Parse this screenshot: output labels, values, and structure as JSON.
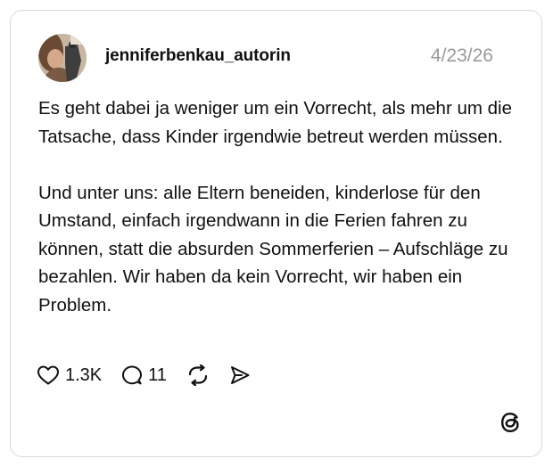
{
  "post": {
    "username": "jenniferbenkau_autorin",
    "date": "4/23/26",
    "paragraphs": [
      "Es geht dabei ja weniger um ein Vorrecht, als mehr um die Tatsache, dass Kinder irgendwie betreut werden müssen.",
      "Und unter uns: alle Eltern beneiden, kinderlose für den Umstand, einfach irgendwann in die Ferien fahren zu können, statt die absurden Sommerferien – Aufschläge zu bezahlen. Wir haben da kein Vorrecht, wir haben ein Problem."
    ],
    "likes": "1.3K",
    "replies": "11"
  },
  "icons": {
    "avatar": "profile-photo",
    "like": "heart-icon",
    "reply": "speech-bubble-icon",
    "repost": "repost-icon",
    "share": "send-icon",
    "brand": "threads-logo"
  },
  "colors": {
    "text": "#101010",
    "muted": "#9a9a9a",
    "border": "#d9d9d9"
  }
}
